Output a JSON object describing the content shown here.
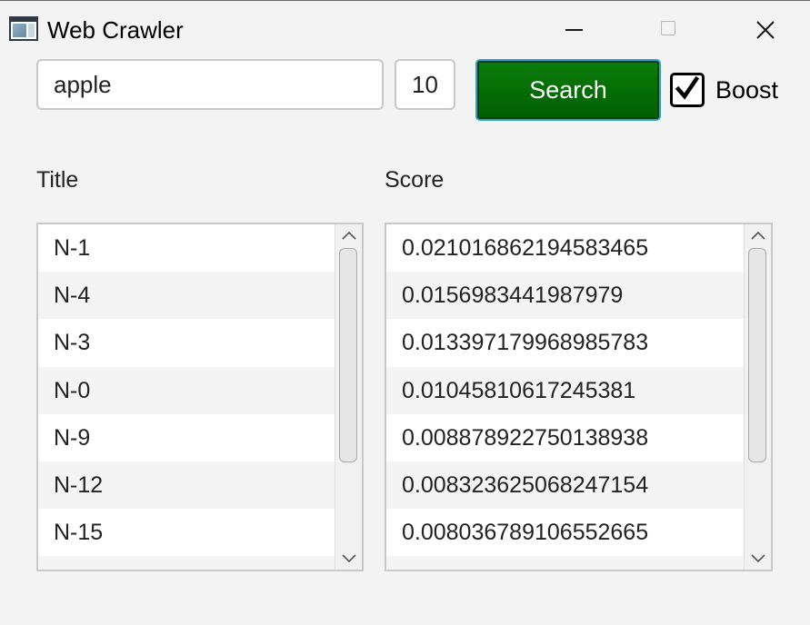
{
  "window": {
    "title": "Web Crawler",
    "icons": {
      "app": "app-window-icon",
      "minimize": "minimize-icon",
      "maximize": "maximize-icon",
      "close": "close-icon"
    }
  },
  "search": {
    "query": "apple",
    "count": "10",
    "button_label": "Search",
    "boost_label": "Boost",
    "boost_checked": true
  },
  "columns": {
    "title": "Title",
    "score": "Score"
  },
  "results": {
    "titles": [
      "N-1",
      "N-4",
      "N-3",
      "N-0",
      "N-9",
      "N-12",
      "N-15",
      ""
    ],
    "scores": [
      "0.021016862194583465",
      "0.0156983441987979",
      "0.013397179968985783",
      "0.01045810617245381",
      "0.008878922750138938",
      "0.008323625068247154",
      "0.008036789106552665",
      ""
    ]
  },
  "colors": {
    "search_button": "#006a00",
    "focus_border": "#2aa3c7",
    "background": "#f3f3f3"
  }
}
